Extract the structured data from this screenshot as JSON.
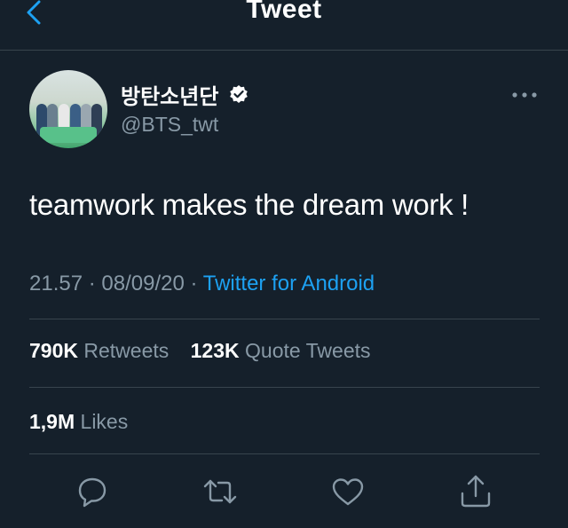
{
  "header": {
    "title": "Tweet",
    "back_icon": "chevron-left-icon"
  },
  "tweet": {
    "display_name": "방탄소년단",
    "verified_icon": "verified-badge-icon",
    "handle": "@BTS_twt",
    "more_icon": "more-horizontal-icon",
    "text": "teamwork makes the dream work !",
    "time": "21.57",
    "separator": "·",
    "date": "08/09/20",
    "source": "Twitter for Android"
  },
  "stats": {
    "retweets_count": "790K",
    "retweets_label": "Retweets",
    "quotes_count": "123K",
    "quotes_label": "Quote Tweets",
    "likes_count": "1,9M",
    "likes_label": "Likes"
  },
  "actions": [
    {
      "icon": "reply-icon"
    },
    {
      "icon": "retweet-icon"
    },
    {
      "icon": "like-heart-icon"
    },
    {
      "icon": "share-icon"
    }
  ],
  "colors": {
    "background": "#15202b",
    "divider": "#38444d",
    "secondary_text": "#8899a6",
    "accent": "#1da1f2"
  }
}
